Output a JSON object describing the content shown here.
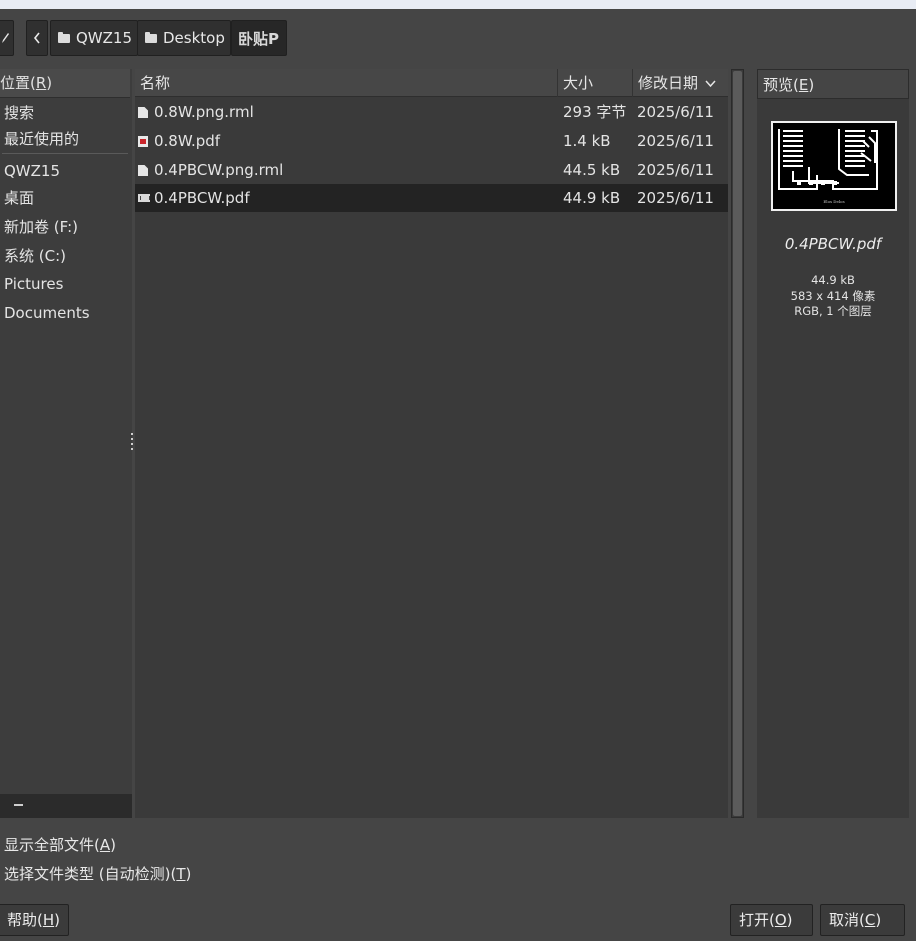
{
  "pathbar": {
    "segments": [
      {
        "label": "QWZ15",
        "icon": "folder-icon"
      },
      {
        "label": "Desktop",
        "icon": "folder-icon"
      },
      {
        "label": "卧贴P"
      }
    ]
  },
  "places": {
    "header_prefix": "位置(",
    "header_key": "R",
    "header_suffix": ")",
    "items": [
      "搜索",
      "最近使用的",
      "QWZ15",
      "桌面",
      "新加卷 (F:)",
      "系统 (C:)",
      "Pictures",
      "Documents"
    ]
  },
  "filelist": {
    "columns": {
      "name": "名称",
      "size": "大小",
      "date": "修改日期"
    },
    "rows": [
      {
        "name": "0.8W.png.rml",
        "size": "293 字节",
        "date": "2025/6/11",
        "icon": "doc"
      },
      {
        "name": "0.8W.pdf",
        "size": "1.4 kB",
        "date": "2025/6/11",
        "icon": "pdf"
      },
      {
        "name": "0.4PBCW.png.rml",
        "size": "44.5 kB",
        "date": "2025/6/11",
        "icon": "doc"
      },
      {
        "name": "0.4PBCW.pdf",
        "size": "44.9 kB",
        "date": "2025/6/11",
        "icon": "thumb",
        "selected": true
      }
    ]
  },
  "preview": {
    "header_prefix": "预览(",
    "header_key": "E",
    "header_suffix": ")",
    "filename": "0.4PBCW.pdf",
    "size": "44.9 kB",
    "dimensions": "583 x 414 像素",
    "mode": "RGB, 1 个图层",
    "thumb_caption": "Elos Delos"
  },
  "options": {
    "show_all_prefix": "显示全部文件(",
    "show_all_key": "A",
    "show_all_suffix": ")",
    "filetype_prefix": "选择文件类型 (自动检测)(",
    "filetype_key": "T",
    "filetype_suffix": ")"
  },
  "buttons": {
    "help_prefix": "帮助(",
    "help_key": "H",
    "help_suffix": ")",
    "open_prefix": "打开(",
    "open_key": "O",
    "open_suffix": ")",
    "cancel_prefix": "取消(",
    "cancel_key": "C",
    "cancel_suffix": ")"
  }
}
